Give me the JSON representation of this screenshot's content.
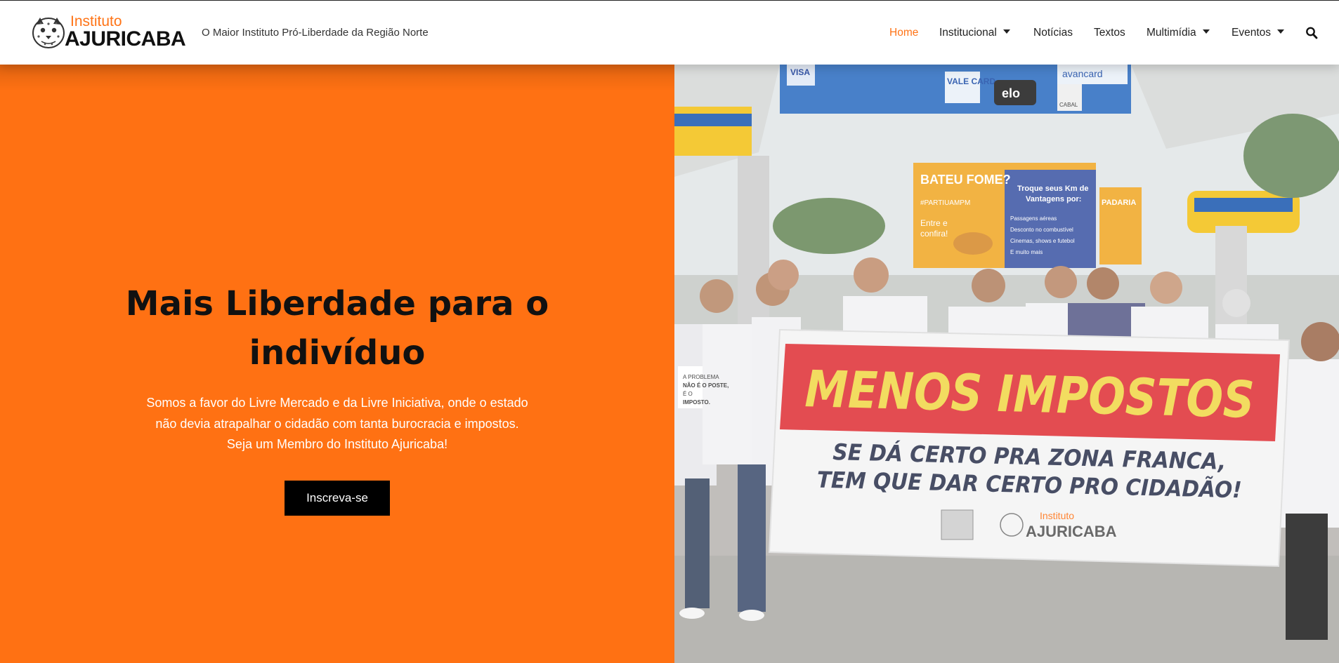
{
  "header": {
    "logo": {
      "small": "Instituto",
      "big": "AJURICABA"
    },
    "tagline": "O Maior Instituto Pró-Liberdade da Região Norte",
    "nav": [
      {
        "label": "Home",
        "active": true
      },
      {
        "label": "Institucional",
        "dropdown": true
      },
      {
        "label": "Notícias"
      },
      {
        "label": "Textos"
      },
      {
        "label": "Multimídia",
        "dropdown": true
      },
      {
        "label": "Eventos",
        "dropdown": true
      }
    ],
    "search_icon": "search-icon"
  },
  "hero": {
    "title": "Mais Liberdade para o indivíduo",
    "text_lines": [
      "Somos a favor do Livre Mercado e da Livre Iniciativa, onde o estado",
      "não devia atrapalhar o cidadão com tanta burocracia e impostos.",
      "Seja um Membro do Instituto Ajuricaba!"
    ],
    "cta": "Inscreva-se"
  },
  "photo": {
    "banner_headline": "MENOS IMPOSTOS",
    "banner_line1": "SE DÁ CERTO PRA ZONA FRANCA,",
    "banner_line2": "TEM QUE DAR CERTO PRO CIDADÃO!",
    "banner_logo_small": "Instituto",
    "banner_logo_big": "AJURICABA",
    "sign_bateu": "BATEU FOME?",
    "sign_troque1": "Troque seus Km de",
    "sign_troque2": "Vantagens por:",
    "sign_hashtag": "#PARTIUAMPM",
    "sign_entre": "Entre e",
    "sign_confira": "confira!",
    "sign_b1": "Passagens aéreas",
    "sign_b2": "Desconto no combustível",
    "sign_b3": "Cinemas, shows e futebol",
    "sign_b4": "E muito mais",
    "sign_padaria": "PADARIA",
    "card_visa": "VISA",
    "card_vale": "VALE CARD",
    "card_elo": "elo",
    "card_avancard": "avancard",
    "card_cabal": "CABAL",
    "shirt_l1": "A PROBLEMA",
    "shirt_l2": "NÃO É O POSTE,",
    "shirt_l3": "É O",
    "shirt_l4": "IMPOSTO.",
    "colors": {
      "orange": "#ff7113",
      "banner_red": "#e0343a",
      "banner_yellow": "#f1d84a"
    }
  }
}
